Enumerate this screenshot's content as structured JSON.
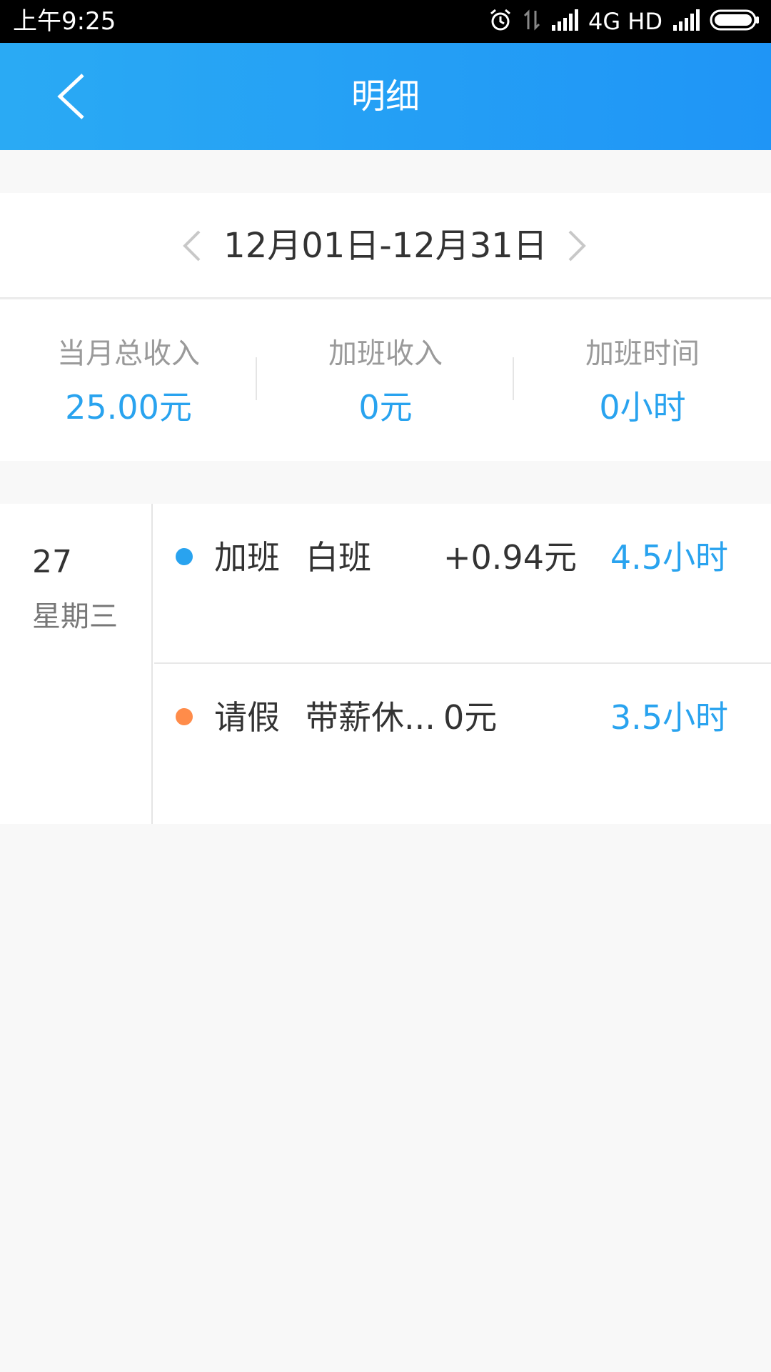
{
  "status_bar": {
    "time": "上午9:25",
    "network": "4G HD",
    "icons": [
      "alarm-icon",
      "data-transfer-icon",
      "signal-icon",
      "signal-icon",
      "battery-icon"
    ]
  },
  "app_bar": {
    "title": "明细",
    "back_icon": "chevron-left-icon"
  },
  "date_nav": {
    "range": "12月01日-12月31日",
    "prev_icon": "chevron-left-icon",
    "next_icon": "chevron-right-icon"
  },
  "summary": [
    {
      "label": "当月总收入",
      "value": "25.00元"
    },
    {
      "label": "加班收入",
      "value": "0元"
    },
    {
      "label": "加班时间",
      "value": "0小时"
    }
  ],
  "day": {
    "number": "27",
    "weekday": "星期三",
    "entries": [
      {
        "type": "加班",
        "subtype": "白班",
        "amount": "+0.94元",
        "hours": "4.5小时",
        "dot_color": "#29a3ef"
      },
      {
        "type": "请假",
        "subtype": "带薪休...",
        "amount": "0元",
        "hours": "3.5小时",
        "dot_color": "#ff8c4a"
      }
    ]
  },
  "colors": {
    "accent": "#29a3ef",
    "header_start": "#2aaaf4",
    "header_end": "#1f95f6",
    "leave_dot": "#ff8c4a"
  }
}
